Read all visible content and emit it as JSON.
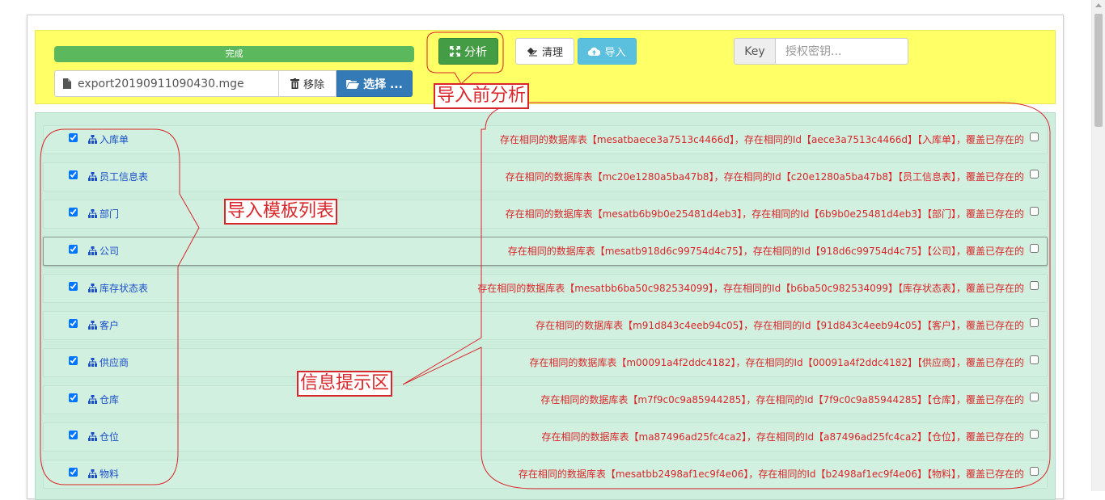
{
  "progress": {
    "label": "完成",
    "value_percent": 100
  },
  "file": {
    "name": "export20190911090430.mge",
    "remove_label": "移除",
    "choose_label": "选择 ..."
  },
  "toolbar": {
    "analyze_label": "分析",
    "clean_label": "清理",
    "import_label": "导入"
  },
  "key": {
    "label": "Key",
    "placeholder": "授权密钥..."
  },
  "annotations": {
    "analyze": "导入前分析",
    "templates": "导入模板列表",
    "messages": "信息提示区"
  },
  "rows": [
    {
      "name": "入库单",
      "message": "存在相同的数据库表【mesatbaece3a7513c4466d】，存在相同的Id【aece3a7513c4466d】【入库单】，覆盖已存在的",
      "checked": true
    },
    {
      "name": "员工信息表",
      "message": "存在相同的数据库表【mc20e1280a5ba47b8】，存在相同的Id【c20e1280a5ba47b8】【员工信息表】，覆盖已存在的",
      "checked": true
    },
    {
      "name": "部门",
      "message": "存在相同的数据库表【mesatb6b9b0e25481d4eb3】，存在相同的Id【6b9b0e25481d4eb3】【部门】，覆盖已存在的",
      "checked": true
    },
    {
      "name": "公司",
      "message": "存在相同的数据库表【mesatb918d6c99754d4c75】，存在相同的Id【918d6c99754d4c75】【公司】，覆盖已存在的",
      "checked": true,
      "selected": true
    },
    {
      "name": "库存状态表",
      "message": "存在相同的数据库表【mesatbb6ba50c982534099】，存在相同的Id【b6ba50c982534099】【库存状态表】，覆盖已存在的",
      "checked": true
    },
    {
      "name": "客户",
      "message": "存在相同的数据库表【m91d843c4eeb94c05】，存在相同的Id【91d843c4eeb94c05】【客户】，覆盖已存在的",
      "checked": true
    },
    {
      "name": "供应商",
      "message": "存在相同的数据库表【m00091a4f2ddc4182】，存在相同的Id【00091a4f2ddc4182】【供应商】，覆盖已存在的",
      "checked": true
    },
    {
      "name": "仓库",
      "message": "存在相同的数据库表【m7f9c0c9a85944285】，存在相同的Id【7f9c0c9a85944285】【仓库】，覆盖已存在的",
      "checked": true
    },
    {
      "name": "仓位",
      "message": "存在相同的数据库表【ma87496ad25fc4ca2】，存在相同的Id【a87496ad25fc4ca2】【仓位】，覆盖已存在的",
      "checked": true
    },
    {
      "name": "物料",
      "message": "存在相同的数据库表【mesatbb2498af1ec9f4e06】，存在相同的Id【b2498af1ec9f4e06】【物料】，覆盖已存在的",
      "checked": true
    }
  ],
  "colors": {
    "toolbar_bg": "#ffff66",
    "list_bg": "#cdeedd",
    "annotation": "#d9262a",
    "link": "#1a4fc9"
  }
}
